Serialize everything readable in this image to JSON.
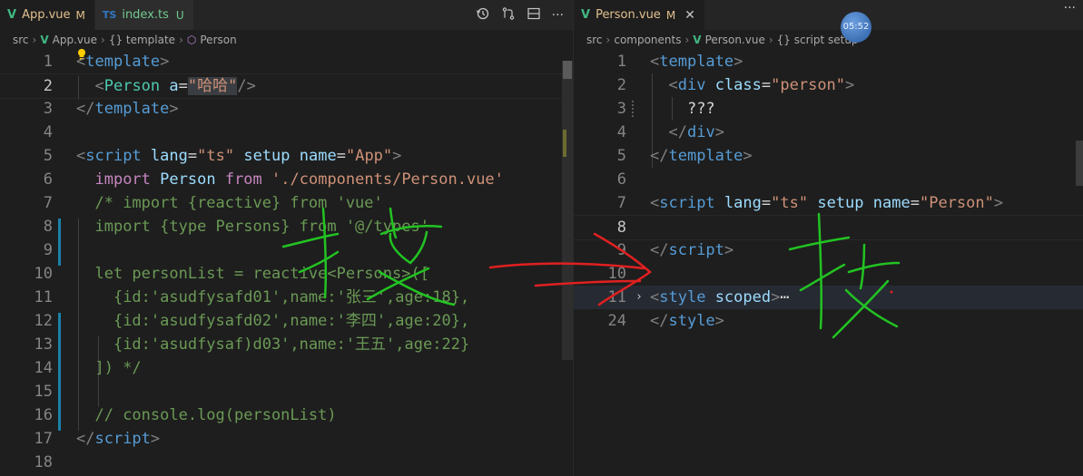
{
  "left": {
    "tabs": [
      {
        "icon": "V",
        "name": "App.vue",
        "badge": "M"
      },
      {
        "icon": "TS",
        "name": "index.ts",
        "badge": "U"
      }
    ],
    "breadcrumb": [
      "src",
      "App.vue",
      "{} template",
      "Person"
    ],
    "lines": {
      "n1": "1",
      "n2": "2",
      "n3": "3",
      "n4": "4",
      "n5": "5",
      "n6": "6",
      "n7": "7",
      "n8": "8",
      "n9": "9",
      "n10": "10",
      "n11": "11",
      "n12": "12",
      "n13": "13",
      "n14": "14",
      "n15": "15",
      "n16": "16",
      "n17": "17",
      "n18": "18"
    },
    "code": {
      "l1_tag": "template",
      "l2_comp": "Person",
      "l2_attr": "a",
      "l2_val": "\"哈哈\"",
      "l3_tag": "template",
      "l5_tag": "script",
      "l5_a1": "lang",
      "l5_v1": "\"ts\"",
      "l5_a2": "setup",
      "l5_a3": "name",
      "l5_v3": "\"App\"",
      "l6_kw1": "import",
      "l6_id": "Person",
      "l6_kw2": "from",
      "l6_str": "'./components/Person.vue'",
      "l7": "/* import {reactive} from 'vue'",
      "l8": "import {type Persons} from '@/types'",
      "l10": "let personList = reactive<Persons>([",
      "l11": "{id:'asudfysafd01',name:'张三',age:18},",
      "l12": "{id:'asudfysafd02',name:'李四',age:20},",
      "l13": "{id:'asudfysaf)d03',name:'王五',age:22}",
      "l14": "]) */",
      "l16": "// console.log(personList)",
      "l17_tag": "script"
    }
  },
  "right": {
    "tabs": [
      {
        "icon": "V",
        "name": "Person.vue",
        "badge": "M"
      }
    ],
    "breadcrumb": [
      "src",
      "components",
      "Person.vue",
      "{} script setup"
    ],
    "lines": {
      "n1": "1",
      "n2": "2",
      "n3": "3",
      "n4": "4",
      "n5": "5",
      "n6": "6",
      "n7": "7",
      "n8": "8",
      "n9": "9",
      "n10": "10",
      "n11": "11",
      "n24": "24"
    },
    "code": {
      "l1_tag": "template",
      "l2_tag": "div",
      "l2_attr": "class",
      "l2_val": "\"person\"",
      "l3": "???",
      "l4_tag": "div",
      "l5_tag": "template",
      "l7_tag": "script",
      "l7_a1": "lang",
      "l7_v1": "\"ts\"",
      "l7_a2": "setup",
      "l7_a3": "name",
      "l7_v3": "\"Person\"",
      "l9_tag": "script",
      "l11_tag": "style",
      "l11_attr": "scoped",
      "l11_ellipsis": "⋯",
      "l24_tag": "style"
    },
    "timer": "05:52"
  },
  "colors": {
    "accent_vue": "#41b883",
    "handwriting_green": "#22c322",
    "handwriting_red": "#e02020"
  }
}
